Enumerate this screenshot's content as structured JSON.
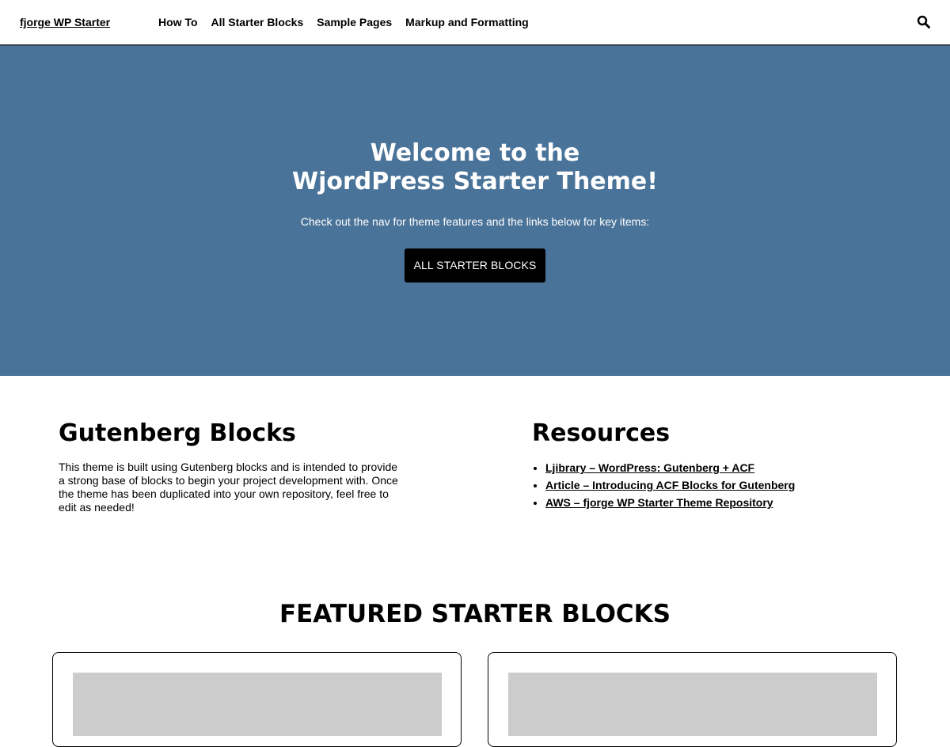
{
  "header": {
    "logo": "fjorge WP Starter",
    "nav": [
      "How To",
      "All Starter Blocks",
      "Sample Pages",
      "Markup and Formatting"
    ],
    "search_icon": "search-icon"
  },
  "hero": {
    "title_line1": "Welcome to the",
    "title_line2": "WjordPress Starter Theme!",
    "subtitle": "Check out the nav for theme features and the links below for key items:",
    "button_label": "ALL STARTER BLOCKS",
    "background_color": "#4a7399"
  },
  "gutenberg": {
    "title": "Gutenberg Blocks",
    "text": "This theme is built using Gutenberg blocks and is intended to provide a strong base of blocks to begin your project development with. Once the theme has been duplicated into your own repository, feel free to edit as needed!"
  },
  "resources": {
    "title": "Resources",
    "links": [
      "Ljibrary – WordPress: Gutenberg + ACF",
      "Article – Introducing ACF Blocks for Gutenberg",
      "AWS – fjorge WP Starter Theme Repository"
    ]
  },
  "featured": {
    "title": "FEATURED STARTER BLOCKS"
  }
}
